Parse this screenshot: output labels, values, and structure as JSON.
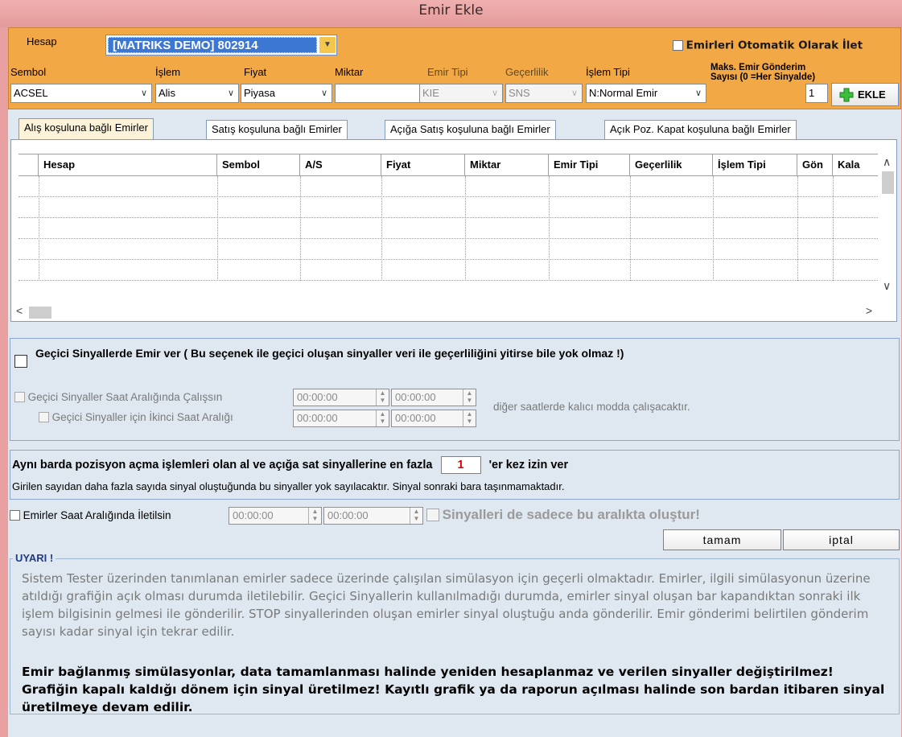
{
  "window": {
    "title": "Emir Ekle"
  },
  "top": {
    "hesap_label": "Hesap",
    "hesap_value": "[MATRIKS DEMO] 802914",
    "auto_send_label": "Emirleri Otomatik Olarak İlet",
    "labels": {
      "sembol": "Sembol",
      "islem": "İşlem",
      "fiyat": "Fiyat",
      "miktar": "Miktar",
      "emir_tipi": "Emir Tipi",
      "gecerlilik": "Geçerlilik",
      "islem_tipi": "İşlem Tipi",
      "maks": "Maks. Emir Gönderim Sayısı (0 =Her Sinyalde)"
    },
    "values": {
      "sembol": "ACSEL",
      "islem": "Alis",
      "fiyat": "Piyasa",
      "miktar": "",
      "emir_tipi": "KIE",
      "gecerlilik": "SNS",
      "islem_tipi": "N:Normal Emir",
      "maks": "1"
    },
    "ekle_label": "EKLE"
  },
  "tabs": [
    "Alış koşuluna bağlı Emirler",
    "Satış koşuluna bağlı Emirler",
    "Açığa Satış koşuluna bağlı Emirler",
    "Açık Poz. Kapat koşuluna bağlı Emirler"
  ],
  "grid": {
    "columns": [
      "Hesap",
      "Sembol",
      "A/S",
      "Fiyat",
      "Miktar",
      "Emir Tipi",
      "Geçerlilik",
      "İşlem Tipi",
      "Gön",
      "Kala"
    ]
  },
  "temp_signals": {
    "main_label": "Geçici Sinyallerde Emir ver ( Bu seçenek ile geçici oluşan sinyaller veri ile geçerliliğini yitirse bile yok olmaz !)",
    "time_range_label": "Geçici Sinyaller Saat Aralığında Çalışsın",
    "second_range_label": "Geçici Sinyaller için İkinci Saat Aralığı",
    "t1_start": "00:00:00",
    "t1_end": "00:00:00",
    "t2_start": "00:00:00",
    "t2_end": "00:00:00",
    "note": "diğer saatlerde kalıcı modda çalışacaktır."
  },
  "same_bar": {
    "text_before": "Aynı barda pozisyon açma işlemleri olan al ve açığa sat sinyallerine en fazla",
    "count": "1",
    "text_after": "'er kez izin ver",
    "note": "Girilen sayıdan daha fazla sayıda sinyal oluştuğunda bu sinyaller yok sayılacaktır. Sinyal sonraki bara taşınmamaktadır."
  },
  "time_filter": {
    "label": "Emirler Saat Aralığında İletilsin",
    "start": "00:00:00",
    "end": "00:00:00",
    "signals_label": "Sinyalleri de sadece bu aralıkta oluştur!"
  },
  "buttons": {
    "ok": "tamam",
    "cancel": "iptal"
  },
  "warning": {
    "title": "UYARI !",
    "paragraph1": "Sistem Tester üzerinden tanımlanan emirler sadece üzerinde çalışılan simülasyon için geçerli olmaktadır. Emirler, ilgili simülasyonun üzerine atıldığı grafiğin açık olması durumda iletilebilir. Geçici Sinyallerin kullanılmadığı durumda, emirler sinyal oluşan bar kapandıktan sonraki ilk işlem bilgisinin gelmesi ile gönderilir. STOP sinyallerinden oluşan emirler sinyal oluştuğu anda gönderilir. Emir gönderimi belirtilen gönderim sayısı kadar sinyal için tekrar edilir.",
    "paragraph2": "Emir bağlanmış simülasyonlar, data tamamlanması halinde yeniden hesaplanmaz ve verilen sinyaller değiştirilmez! Grafiğin kapalı kaldığı dönem için sinyal üretilmez! Kayıtlı grafik ya da raporun açılması halinde son bardan itibaren sinyal üretilmeye devam edilir."
  },
  "colors": {
    "top_panel": "#f2a845",
    "accent_blue": "#3d77d4",
    "body_bg": "#dfe8f1",
    "count_red": "#e00000"
  }
}
